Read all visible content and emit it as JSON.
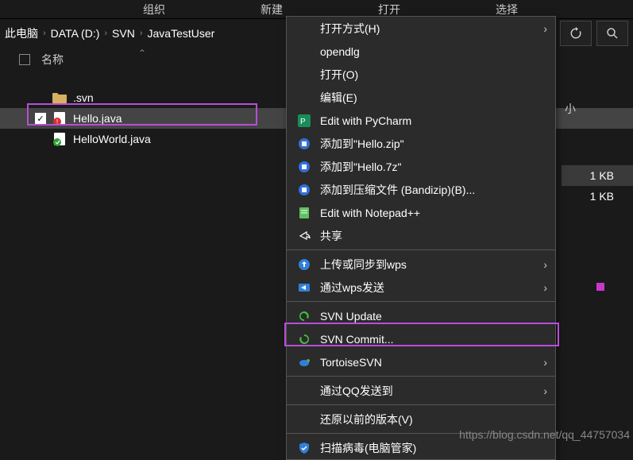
{
  "toolbar": {
    "tabs": [
      "组织",
      "新建",
      "打开",
      "选择"
    ]
  },
  "breadcrumb": {
    "root": "此电脑",
    "drive": "DATA (D:)",
    "folder1": "SVN",
    "folder2": "JavaTestUser"
  },
  "columns": {
    "name": "名称",
    "size": "小"
  },
  "files": {
    "items": [
      {
        "name": ".svn",
        "size": ""
      },
      {
        "name": "Hello.java",
        "size": "1 KB"
      },
      {
        "name": "HelloWorld.java",
        "size": "1 KB"
      }
    ]
  },
  "context_menu": {
    "open_with": "打开方式(H)",
    "opendlg": "opendlg",
    "open": "打开(O)",
    "edit": "编辑(E)",
    "pycharm": "Edit with PyCharm",
    "add_zip": "添加到\"Hello.zip\"",
    "add_7z": "添加到\"Hello.7z\"",
    "add_bandizip": "添加到压缩文件 (Bandizip)(B)...",
    "notepad": "Edit with Notepad++",
    "share": "共享",
    "wps_upload": "上传或同步到wps",
    "wps_send": "通过wps发送",
    "svn_update": "SVN Update",
    "svn_commit": "SVN Commit...",
    "tortoise": "TortoiseSVN",
    "qq_send": "通过QQ发送到",
    "restore": "还原以前的版本(V)",
    "scan": "扫描病毒(电脑管家)"
  },
  "watermark": "https://blog.csdn.net/qq_44757034"
}
